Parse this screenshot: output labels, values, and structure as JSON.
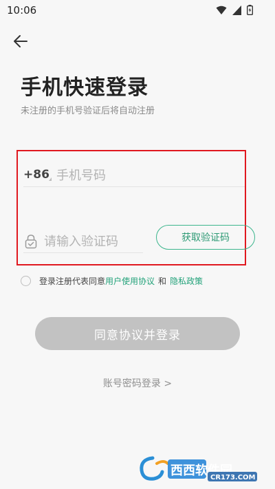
{
  "status_bar": {
    "time": "10:06"
  },
  "header": {
    "title": "手机快速登录",
    "subtitle": "未注册的手机号验证后将自动注册"
  },
  "form": {
    "country_code": "+86",
    "phone_placeholder": "手机号码",
    "code_placeholder": "请输入验证码",
    "get_code_label": "获取验证码"
  },
  "agreement": {
    "prefix": "登录注册代表同意",
    "user_agreement": "用户使用协议",
    "and": "和",
    "privacy_policy": "隐私政策"
  },
  "actions": {
    "login_label": "同意协议并登录",
    "password_login_label": "账号密码登录 >"
  },
  "watermark": {
    "name": "西西软件园",
    "url": "CR173.COM"
  },
  "colors": {
    "accent": "#2e9a75",
    "highlight_border": "#e0171e",
    "disabled_button": "#c2c2c2"
  },
  "icons": [
    "wifi-icon",
    "signal-icon",
    "battery-icon",
    "back-arrow-icon",
    "lock-icon"
  ]
}
